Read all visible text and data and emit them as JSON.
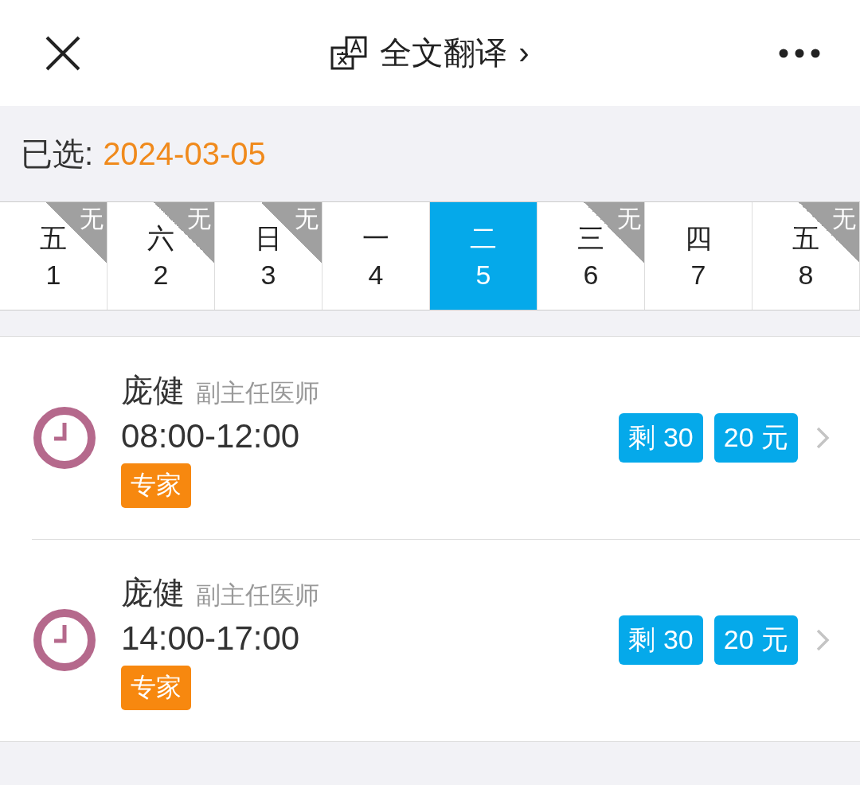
{
  "header": {
    "title": "全文翻译",
    "chevron": "›"
  },
  "selected_date": {
    "label": "已选:",
    "value": "2024-03-05"
  },
  "days": [
    {
      "weekday": "五",
      "day": "1",
      "selected": false,
      "badge": "无"
    },
    {
      "weekday": "六",
      "day": "2",
      "selected": false,
      "badge": "无"
    },
    {
      "weekday": "日",
      "day": "3",
      "selected": false,
      "badge": "无"
    },
    {
      "weekday": "一",
      "day": "4",
      "selected": false
    },
    {
      "weekday": "二",
      "day": "5",
      "selected": true
    },
    {
      "weekday": "三",
      "day": "6",
      "selected": false,
      "badge": "无"
    },
    {
      "weekday": "四",
      "day": "7",
      "selected": false
    },
    {
      "weekday": "五",
      "day": "8",
      "selected": false,
      "badge": "无"
    }
  ],
  "slots": [
    {
      "doctor": "庞健",
      "title": "副主任医师",
      "time": "08:00-12:00",
      "tag": "专家",
      "remaining": "剩 30",
      "price": "20 元"
    },
    {
      "doctor": "庞健",
      "title": "副主任医师",
      "time": "14:00-17:00",
      "tag": "专家",
      "remaining": "剩 30",
      "price": "20 元"
    }
  ]
}
